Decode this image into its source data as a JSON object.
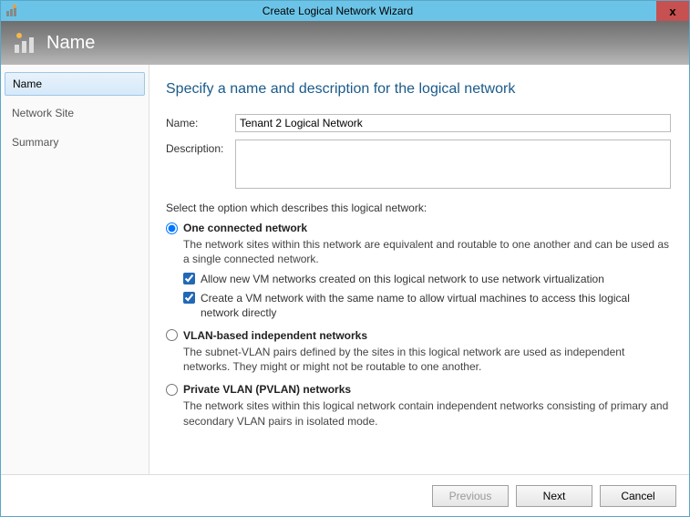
{
  "window": {
    "title": "Create Logical Network Wizard",
    "close": "x"
  },
  "header": {
    "title": "Name"
  },
  "sidebar": {
    "items": [
      {
        "label": "Name"
      },
      {
        "label": "Network Site"
      },
      {
        "label": "Summary"
      }
    ]
  },
  "main": {
    "heading": "Specify a name and description for the logical network",
    "name_label": "Name:",
    "name_value": "Tenant 2 Logical Network",
    "desc_label": "Description:",
    "desc_value": "",
    "section_text": "Select the option which describes this logical network:",
    "options": [
      {
        "label": "One connected network",
        "desc": "The network sites within this network are equivalent and routable to one another and can be used as a single connected network.",
        "checkboxes": [
          {
            "label": "Allow new VM networks created on this logical network to use network virtualization"
          },
          {
            "label": "Create a VM network with the same name to allow virtual machines to access this logical network directly"
          }
        ]
      },
      {
        "label": "VLAN-based independent networks",
        "desc": "The subnet-VLAN pairs defined by the sites in this logical network are used as independent networks. They might or might not be routable to one another."
      },
      {
        "label": "Private VLAN (PVLAN) networks",
        "desc": "The network sites within this logical network contain independent networks consisting of primary and secondary VLAN pairs in isolated mode."
      }
    ]
  },
  "footer": {
    "previous": "Previous",
    "next": "Next",
    "cancel": "Cancel"
  }
}
